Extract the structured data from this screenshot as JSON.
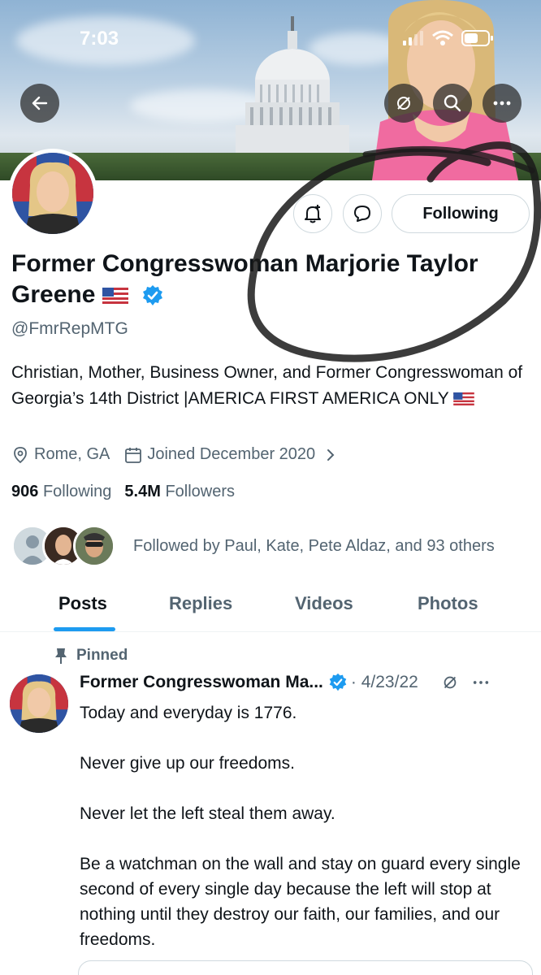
{
  "status_bar": {
    "time": "7:03"
  },
  "header": {
    "back_icon": "arrow-left-icon",
    "actions": [
      "grok-icon",
      "search-icon",
      "more-icon"
    ]
  },
  "profile": {
    "name": "Former Congresswoman Marjorie Taylor Greene",
    "handle": "@FmrRepMTG",
    "bio": "Christian, Mother, Business Owner, and Former Congresswoman of Georgia’s 14th District |AMERICA FIRST AMERICA ONLY",
    "location": "Rome, GA",
    "joined": "Joined December 2020",
    "following_count": "906",
    "following_label": "Following",
    "followers_count": "5.4M",
    "followers_label": "Followers",
    "followed_by": "Followed by Paul, Kate, Pete Aldaz, and 93 others",
    "follow_button": "Following",
    "verified_color": "#1d9bf0"
  },
  "tabs": [
    {
      "label": "Posts"
    },
    {
      "label": "Replies"
    },
    {
      "label": "Videos"
    },
    {
      "label": "Photos"
    }
  ],
  "pinned_post": {
    "pinned_label": "Pinned",
    "author": "Former Congresswoman Ma...",
    "date": "· 4/23/22",
    "paragraphs": [
      "Today and everyday is 1776.",
      "Never give up our freedoms.",
      "Never let the left steal them away.",
      "Be a watchman on the wall and stay on guard every single second of every single day because the left will stop at nothing until they destroy our faith, our families, and our freedoms."
    ]
  },
  "colors": {
    "accent": "#1d9bf0",
    "text": "#0f1419",
    "secondary": "#536471"
  }
}
